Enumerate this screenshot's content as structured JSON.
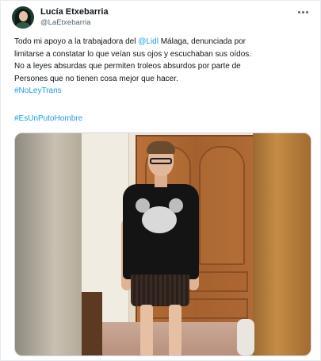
{
  "tweet": {
    "author": {
      "display_name": "Lucía Etxebarria",
      "handle": "@LaEtxebarria"
    },
    "text": {
      "line1_before": "Todo mi apoyo a la trabajadora del ",
      "line1_mention": "@Lidl",
      "line1_after": " Málaga, denunciada  por",
      "line2": "limitarse a constatar lo que veían sus ojos y escuchaban sus oídos.",
      "line3": "No a leyes absurdas que permiten troleos absurdos por parte de",
      "line4": "Persones que no tienen cosa mejor que hacer.",
      "hashtag1": "#NoLeyTrans",
      "hashtag2": "#EsUnPutoHombre"
    },
    "more_icon": "more-horizontal-icon",
    "accent_color": "#1d9bf0"
  }
}
